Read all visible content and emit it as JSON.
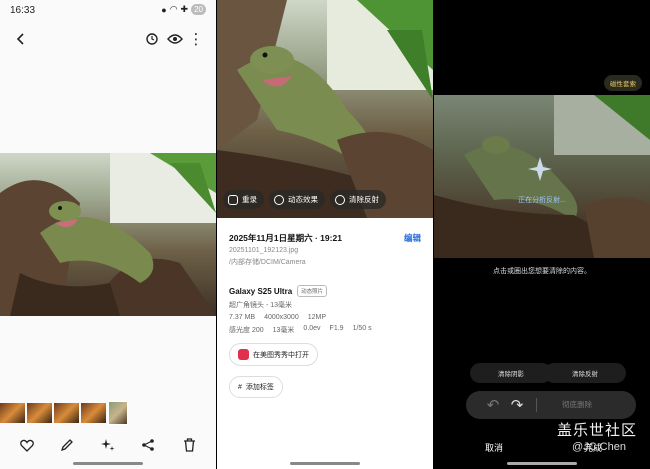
{
  "status_bar": {
    "time": "16:33",
    "battery": "20"
  },
  "viewer": {
    "icons": [
      "back-arrow-icon",
      "remaster-icon",
      "eye-icon",
      "more-icon"
    ],
    "bottom_icons": [
      "heart-icon",
      "pencil-icon",
      "sparkle-icon",
      "share-icon",
      "trash-icon"
    ]
  },
  "details": {
    "chips": {
      "remaster": "重录",
      "motion": "动态效果",
      "remove_reflection": "清除反射"
    },
    "date_time": "2025年11月1日星期六 · 19:21",
    "edit": "编辑",
    "filename": "20251101_192123.jpg",
    "path": "/内部存储/DCIM/Camera",
    "device": "Galaxy S25 Ultra",
    "device_badge": "动态照片",
    "lens": "超广角镜头 - 13毫米",
    "specs_row1": [
      "7.37 MB",
      "4000x3000",
      "12MP"
    ],
    "specs_row2": [
      "感光度 200",
      "13毫米",
      "0.0ev",
      "F1.9",
      "1/50 s"
    ],
    "open_in_app": "在美图秀秀中打开",
    "add_tag": "添加标签"
  },
  "eraser": {
    "tag": "磁性套索",
    "analyzing": "正在分析反射...",
    "hint": "点击或圈出您想要清除的内容。",
    "remove_shadow": "清除阴影",
    "remove_reflection": "清除反射",
    "erase_all": "彻底删除",
    "cancel": "取消",
    "done": "完成"
  },
  "watermark": {
    "brand": "盖乐世社区",
    "author": "@JC.Chen"
  }
}
